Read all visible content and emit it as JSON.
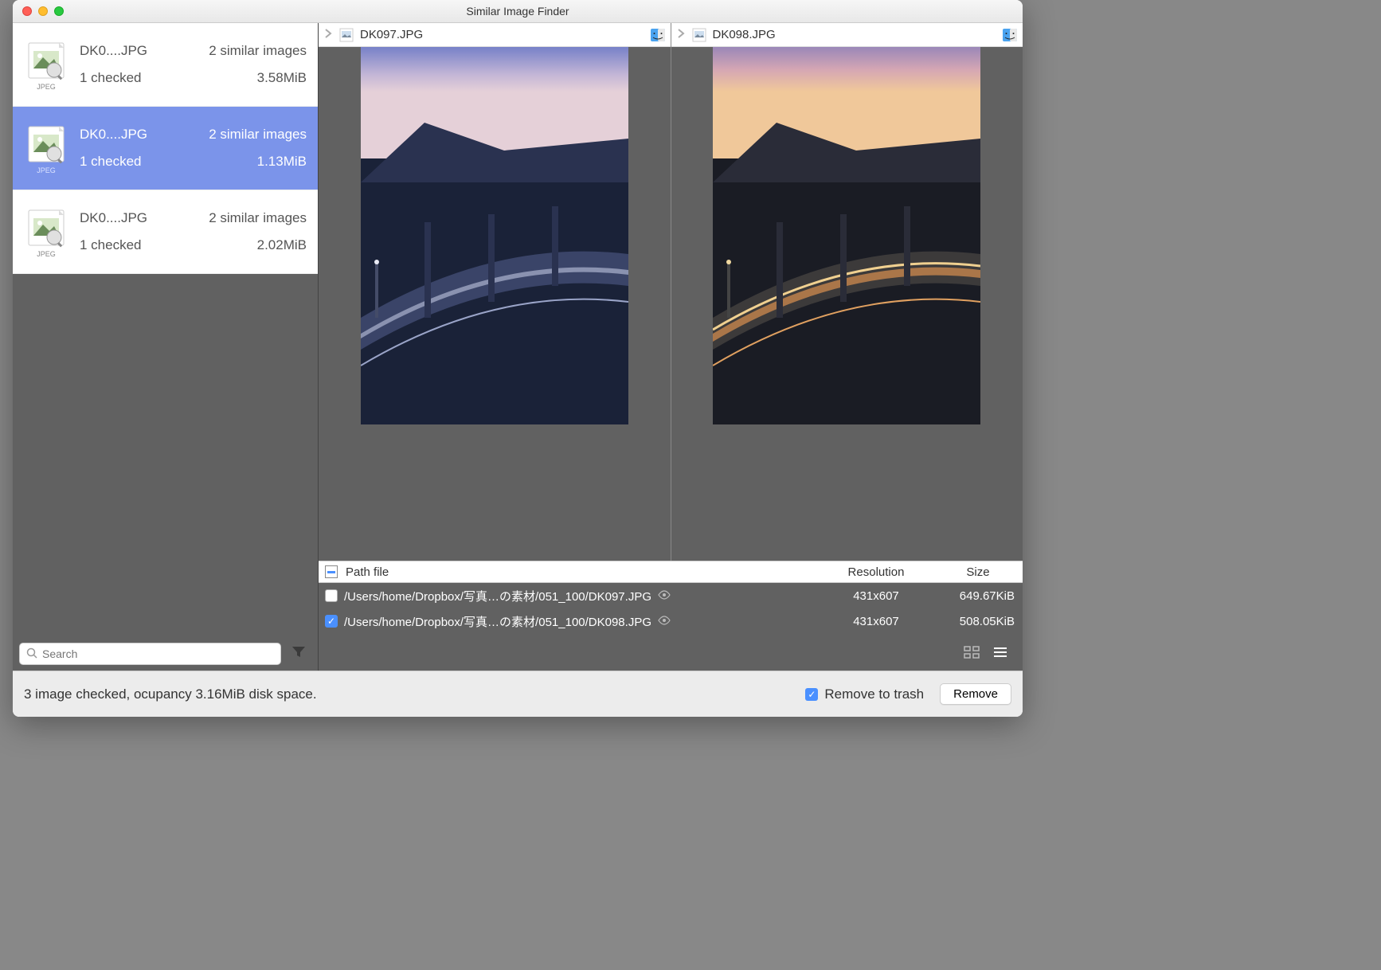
{
  "window": {
    "title": "Similar Image Finder"
  },
  "sidebar": {
    "items": [
      {
        "filename": "DK0....JPG",
        "type_label": "JPEG",
        "similar": "2 similar images",
        "checked": "1 checked",
        "size": "3.58MiB",
        "selected": false
      },
      {
        "filename": "DK0....JPG",
        "type_label": "JPEG",
        "similar": "2 similar images",
        "checked": "1 checked",
        "size": "1.13MiB",
        "selected": true
      },
      {
        "filename": "DK0....JPG",
        "type_label": "JPEG",
        "similar": "2 similar images",
        "checked": "1 checked",
        "size": "2.02MiB",
        "selected": false
      }
    ],
    "search_placeholder": "Search"
  },
  "preview": {
    "left": {
      "name": "DK097.JPG"
    },
    "right": {
      "name": "DK098.JPG"
    }
  },
  "table": {
    "headers": {
      "path": "Path file",
      "resolution": "Resolution",
      "size": "Size"
    },
    "rows": [
      {
        "checked": false,
        "path": "/Users/home/Dropbox/写真…の素材/051_100/DK097.JPG",
        "resolution": "431x607",
        "size": "649.67KiB"
      },
      {
        "checked": true,
        "path": "/Users/home/Dropbox/写真…の素材/051_100/DK098.JPG",
        "resolution": "431x607",
        "size": "508.05KiB"
      }
    ]
  },
  "footer": {
    "status": "3 image checked, ocupancy 3.16MiB disk space.",
    "remove_to_trash_label": "Remove to trash",
    "remove_button": "Remove"
  }
}
